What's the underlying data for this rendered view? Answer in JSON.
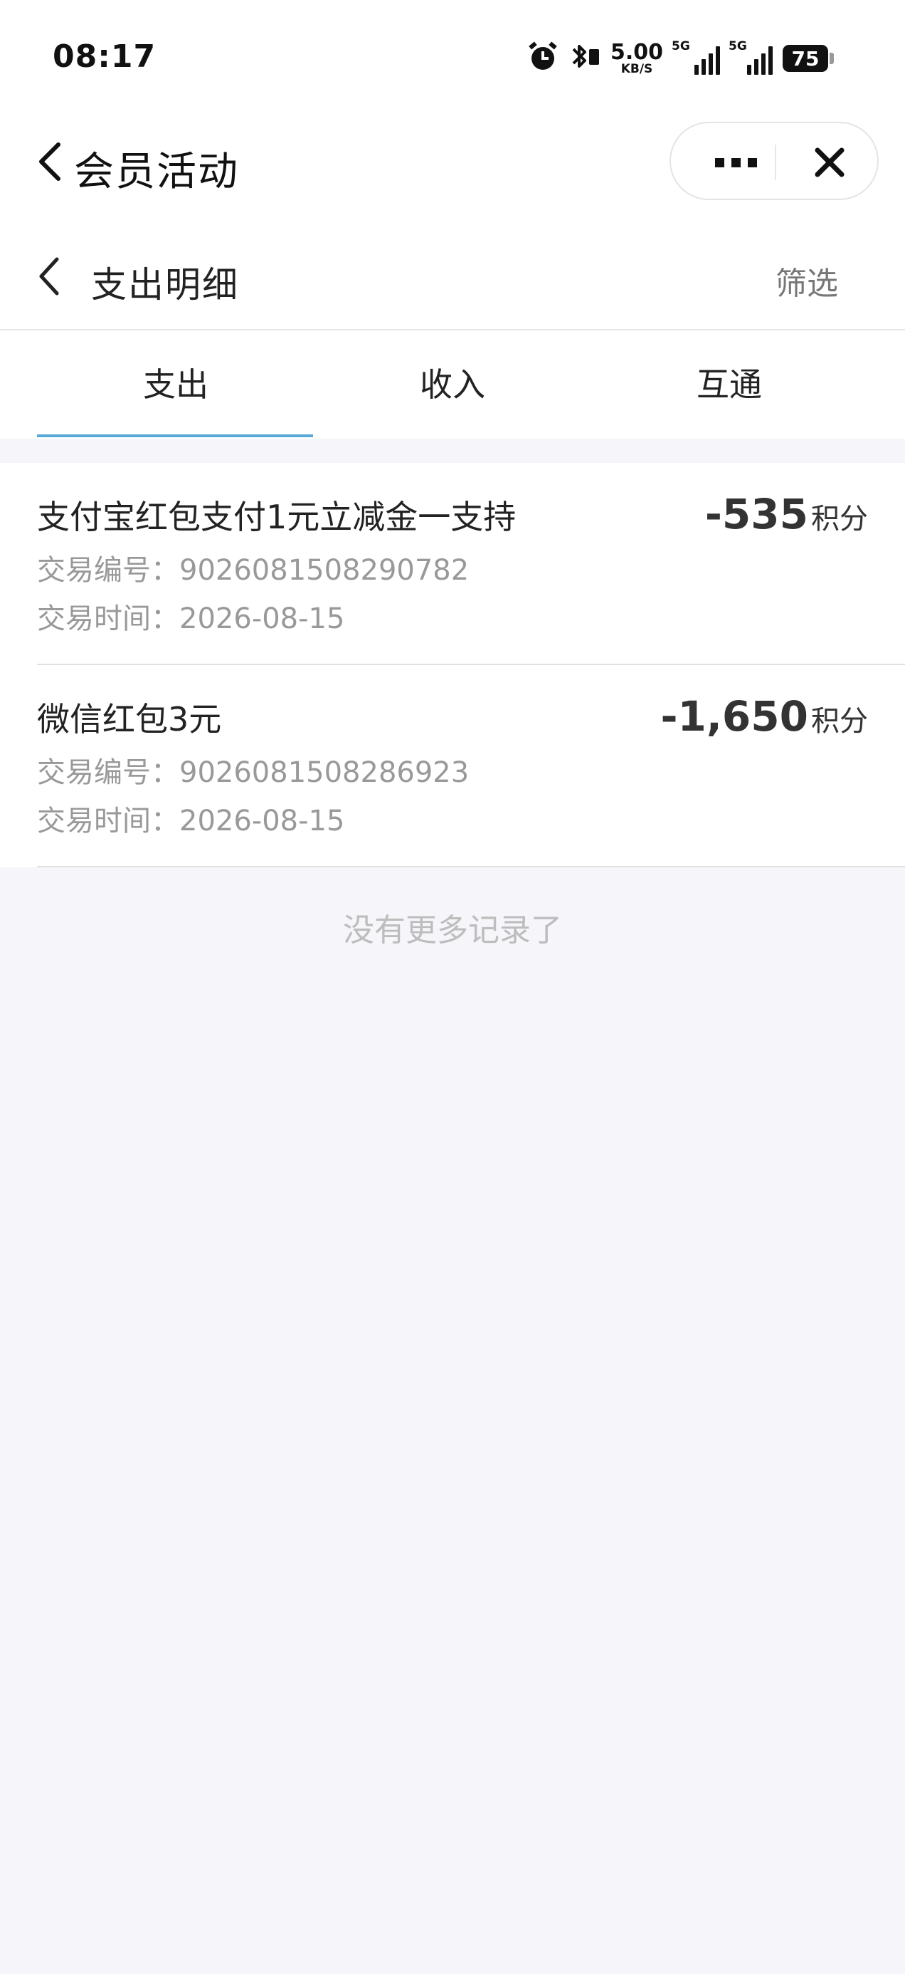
{
  "status_bar": {
    "time": "08:17",
    "speed_value": "5.00",
    "speed_unit": "KB/S",
    "signal1_tag": "5G",
    "signal2_tag": "5G",
    "battery": "75"
  },
  "mini_app": {
    "title": "会员活动"
  },
  "page": {
    "title": "支出明细",
    "filter_label": "筛选"
  },
  "tabs": [
    {
      "label": "支出",
      "active": true
    },
    {
      "label": "收入",
      "active": false
    },
    {
      "label": "互通",
      "active": false
    }
  ],
  "records": [
    {
      "title": "支付宝红包支付1元立减金一支持",
      "id_line": "交易编号：9026081508290782",
      "time_line": "交易时间：2026-08-15",
      "amount": "-535",
      "unit": "积分"
    },
    {
      "title": "微信红包3元",
      "id_line": "交易编号：9026081508286923",
      "time_line": "交易时间：2026-08-15",
      "amount": "-1,650",
      "unit": "积分"
    }
  ],
  "footer": {
    "no_more": "没有更多记录了"
  },
  "colors": {
    "tab_underline": "#56a8d8",
    "background": "#f5f5fa"
  }
}
